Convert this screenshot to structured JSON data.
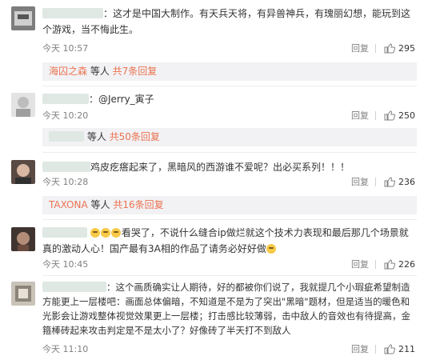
{
  "comments": [
    {
      "text": "：这才是中国大制作。有天兵天将，有异兽神兵，有瑰丽幻想，能玩到这个游戏，当不悔此生。",
      "time": "今天 10:57",
      "reply_label": "回复",
      "likes": "295",
      "subreply": {
        "author": "海囚之森",
        "middle": " 等人 ",
        "count": "共7条回复"
      }
    },
    {
      "text": "：@Jerry_寅子",
      "time": "今天 10:20",
      "reply_label": "回复",
      "likes": "250",
      "subreply": {
        "author": "",
        "middle": " 等人 ",
        "count": "共50条回复"
      }
    },
    {
      "text": "鸡皮疙瘩起来了，黑暗风的西游谁不爱呢？出必买系列！！！",
      "time": "今天 10:28",
      "reply_label": "回复",
      "likes": "236",
      "subreply": {
        "author": "TAXONA",
        "middle": " 等人 ",
        "count": "共16条回复"
      }
    },
    {
      "text": "看哭了，不说什么缝合ip做烂就这个技术力表现和最后那几个场景就真的激动人心！国产最有3A相的作品了请务必好好做",
      "time": "今天 10:45",
      "reply_label": "回复",
      "likes": "226"
    },
    {
      "text": "：这个画质确实让人期待，好的都被你们说了，我就提几个小瑕疵希望制造方能更上一层楼吧：画面总体偏暗，不知道是不是为了突出\"黑暗\"题材，但是适当的暖色和光影会让游戏整体视觉效果更上一层楼；打击感比较薄弱，击中敌人的音效也有待提高，金箍棒砖起来攻击判定是不是太小了？好像砖了半天打不到敌人",
      "time": "今天 11:10",
      "reply_label": "回复",
      "likes": "211"
    }
  ],
  "colors": {
    "accent": "#eb7350",
    "meta": "#808080",
    "reply_bg": "#f2f2f5"
  },
  "icons": {
    "like": "thumbs-up-icon"
  }
}
